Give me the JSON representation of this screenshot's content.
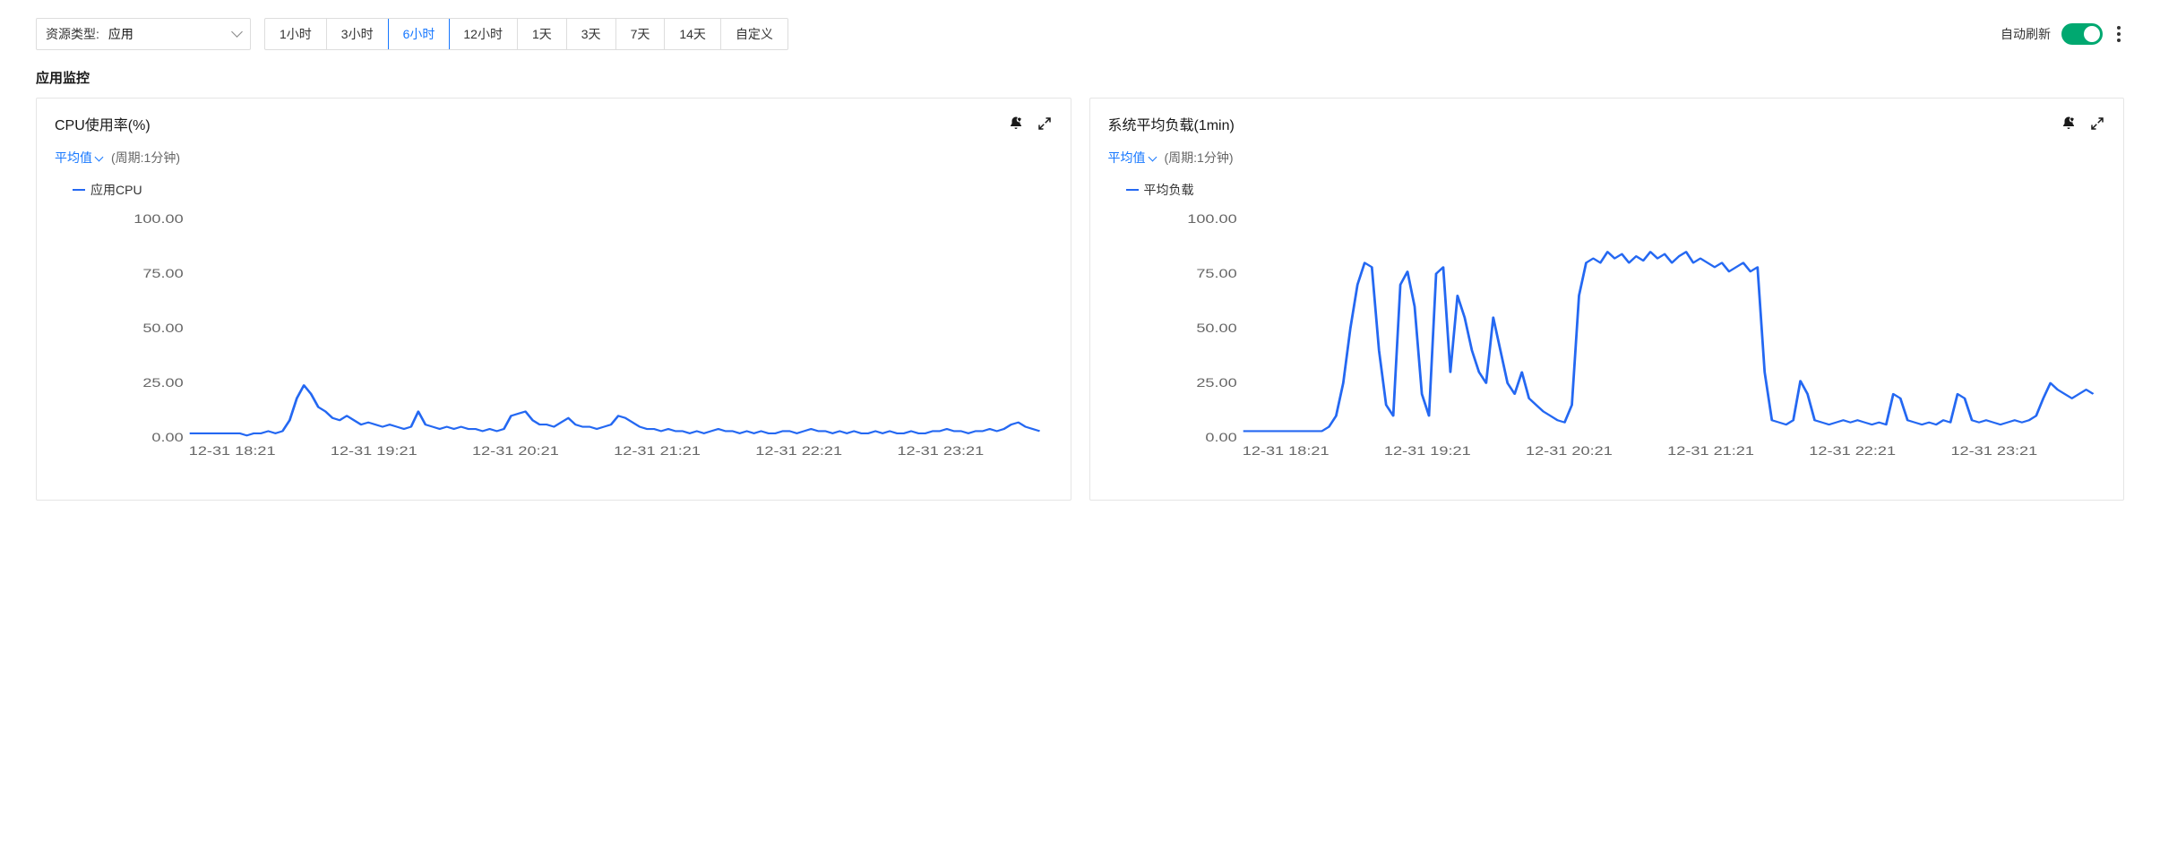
{
  "filters": {
    "resource_type_label": "资源类型:",
    "resource_type_value": "应用"
  },
  "time_tabs": [
    {
      "label": "1小时",
      "active": false
    },
    {
      "label": "3小时",
      "active": false
    },
    {
      "label": "6小时",
      "active": true
    },
    {
      "label": "12小时",
      "active": false
    },
    {
      "label": "1天",
      "active": false
    },
    {
      "label": "3天",
      "active": false
    },
    {
      "label": "7天",
      "active": false
    },
    {
      "label": "14天",
      "active": false
    },
    {
      "label": "自定义",
      "active": false
    }
  ],
  "auto_refresh": {
    "label": "自动刷新",
    "on": true
  },
  "section_title": "应用监控",
  "panels": [
    {
      "title": "CPU使用率(%)",
      "agg_label": "平均值",
      "period_text": "(周期:1分钟)",
      "legend": "应用CPU",
      "y_ticks": [
        "100.00",
        "75.00",
        "50.00",
        "25.00",
        "0.00"
      ],
      "x_ticks": [
        "12-31 18:21",
        "12-31 19:21",
        "12-31 20:21",
        "12-31 21:21",
        "12-31 22:21",
        "12-31 23:21"
      ]
    },
    {
      "title": "系统平均负载(1min)",
      "agg_label": "平均值",
      "period_text": "(周期:1分钟)",
      "legend": "平均负载",
      "y_ticks": [
        "100.00",
        "75.00",
        "50.00",
        "25.00",
        "0.00"
      ],
      "x_ticks": [
        "12-31 18:21",
        "12-31 19:21",
        "12-31 20:21",
        "12-31 21:21",
        "12-31 22:21",
        "12-31 23:21"
      ]
    }
  ],
  "chart_data": [
    {
      "type": "line",
      "title": "CPU使用率(%)",
      "ylabel": "",
      "xlabel": "",
      "ylim": [
        0,
        100
      ],
      "x_categories": [
        "12-31 18:21",
        "12-31 19:21",
        "12-31 20:21",
        "12-31 21:21",
        "12-31 22:21",
        "12-31 23:21"
      ],
      "series": [
        {
          "name": "应用CPU",
          "values": [
            2,
            2,
            2,
            2,
            2,
            2,
            2,
            2,
            1,
            2,
            2,
            3,
            2,
            3,
            8,
            18,
            24,
            20,
            14,
            12,
            9,
            8,
            10,
            8,
            6,
            7,
            6,
            5,
            6,
            5,
            4,
            5,
            12,
            6,
            5,
            4,
            5,
            4,
            5,
            4,
            4,
            3,
            4,
            3,
            4,
            10,
            11,
            12,
            8,
            6,
            6,
            5,
            7,
            9,
            6,
            5,
            5,
            4,
            5,
            6,
            10,
            9,
            7,
            5,
            4,
            4,
            3,
            4,
            3,
            3,
            2,
            3,
            2,
            3,
            4,
            3,
            3,
            2,
            3,
            2,
            3,
            2,
            2,
            3,
            3,
            2,
            3,
            4,
            3,
            3,
            2,
            3,
            2,
            3,
            2,
            2,
            3,
            2,
            3,
            2,
            2,
            3,
            2,
            2,
            3,
            3,
            4,
            3,
            3,
            2,
            3,
            3,
            4,
            3,
            4,
            6,
            7,
            5,
            4,
            3
          ]
        }
      ]
    },
    {
      "type": "line",
      "title": "系统平均负载(1min)",
      "ylabel": "",
      "xlabel": "",
      "ylim": [
        0,
        100
      ],
      "x_categories": [
        "12-31 18:21",
        "12-31 19:21",
        "12-31 20:21",
        "12-31 21:21",
        "12-31 22:21",
        "12-31 23:21"
      ],
      "series": [
        {
          "name": "平均负载",
          "values": [
            3,
            3,
            3,
            3,
            3,
            3,
            3,
            3,
            3,
            3,
            3,
            3,
            5,
            10,
            25,
            50,
            70,
            80,
            78,
            40,
            15,
            10,
            70,
            76,
            60,
            20,
            10,
            75,
            78,
            30,
            65,
            55,
            40,
            30,
            25,
            55,
            40,
            25,
            20,
            30,
            18,
            15,
            12,
            10,
            8,
            7,
            15,
            65,
            80,
            82,
            80,
            85,
            82,
            84,
            80,
            83,
            81,
            85,
            82,
            84,
            80,
            83,
            85,
            80,
            82,
            80,
            78,
            80,
            76,
            78,
            80,
            76,
            78,
            30,
            8,
            7,
            6,
            8,
            26,
            20,
            8,
            7,
            6,
            7,
            8,
            7,
            8,
            7,
            6,
            7,
            6,
            20,
            18,
            8,
            7,
            6,
            7,
            6,
            8,
            7,
            20,
            18,
            8,
            7,
            8,
            7,
            6,
            7,
            8,
            7,
            8,
            10,
            18,
            25,
            22,
            20,
            18,
            20,
            22,
            20
          ]
        }
      ]
    }
  ]
}
